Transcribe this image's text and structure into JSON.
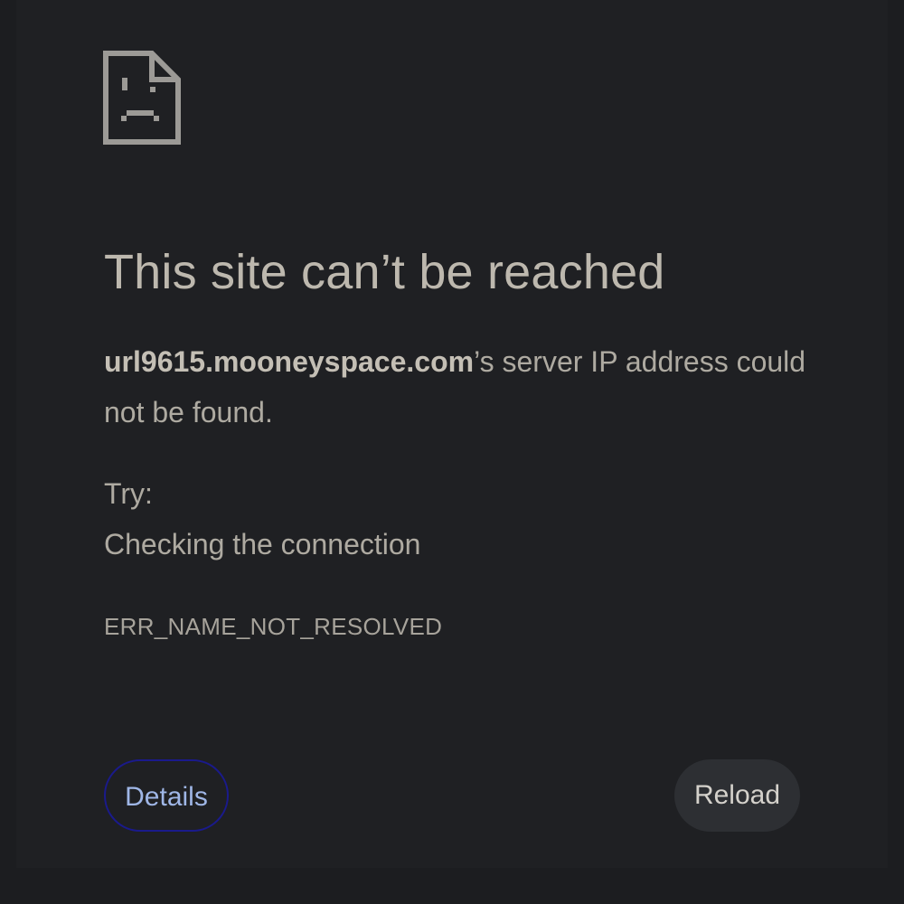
{
  "error_page": {
    "icon": "sad-page-icon",
    "title": "This site can’t be reached",
    "description": {
      "host": "url9615.mooneyspace.com",
      "message": "’s server IP address could not be found."
    },
    "try_label": "Try:",
    "suggestions": [
      "Checking the connection"
    ],
    "error_code": "ERR_NAME_NOT_RESOLVED"
  },
  "buttons": {
    "details_label": "Details",
    "reload_label": "Reload"
  },
  "colors": {
    "background": "#1f2023",
    "text": "#aeaaa1",
    "details_border": "#1a1a8c",
    "details_text": "#9fb6e6",
    "reload_bg": "#2d2f33"
  }
}
